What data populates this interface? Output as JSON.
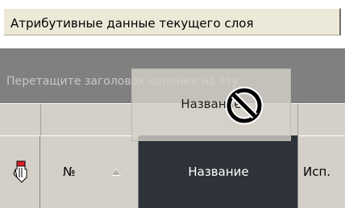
{
  "tab": {
    "label": "Атрибутивные данные текущего слоя"
  },
  "group_panel": {
    "hint": "Перетащите заголовок колонки на эту"
  },
  "columns": [
    {
      "label": "№",
      "sort": "ascending"
    },
    {
      "label": "Название"
    },
    {
      "label": "Исп."
    }
  ],
  "drag": {
    "label": "Название"
  },
  "icons": {
    "row_selector": "edit-pencil-icon",
    "sort": "sort-ascending-icon",
    "cursor": "no-drop-cursor-icon"
  },
  "colors": {
    "selected_header": "#2d3338",
    "group_panel": "#808080"
  }
}
